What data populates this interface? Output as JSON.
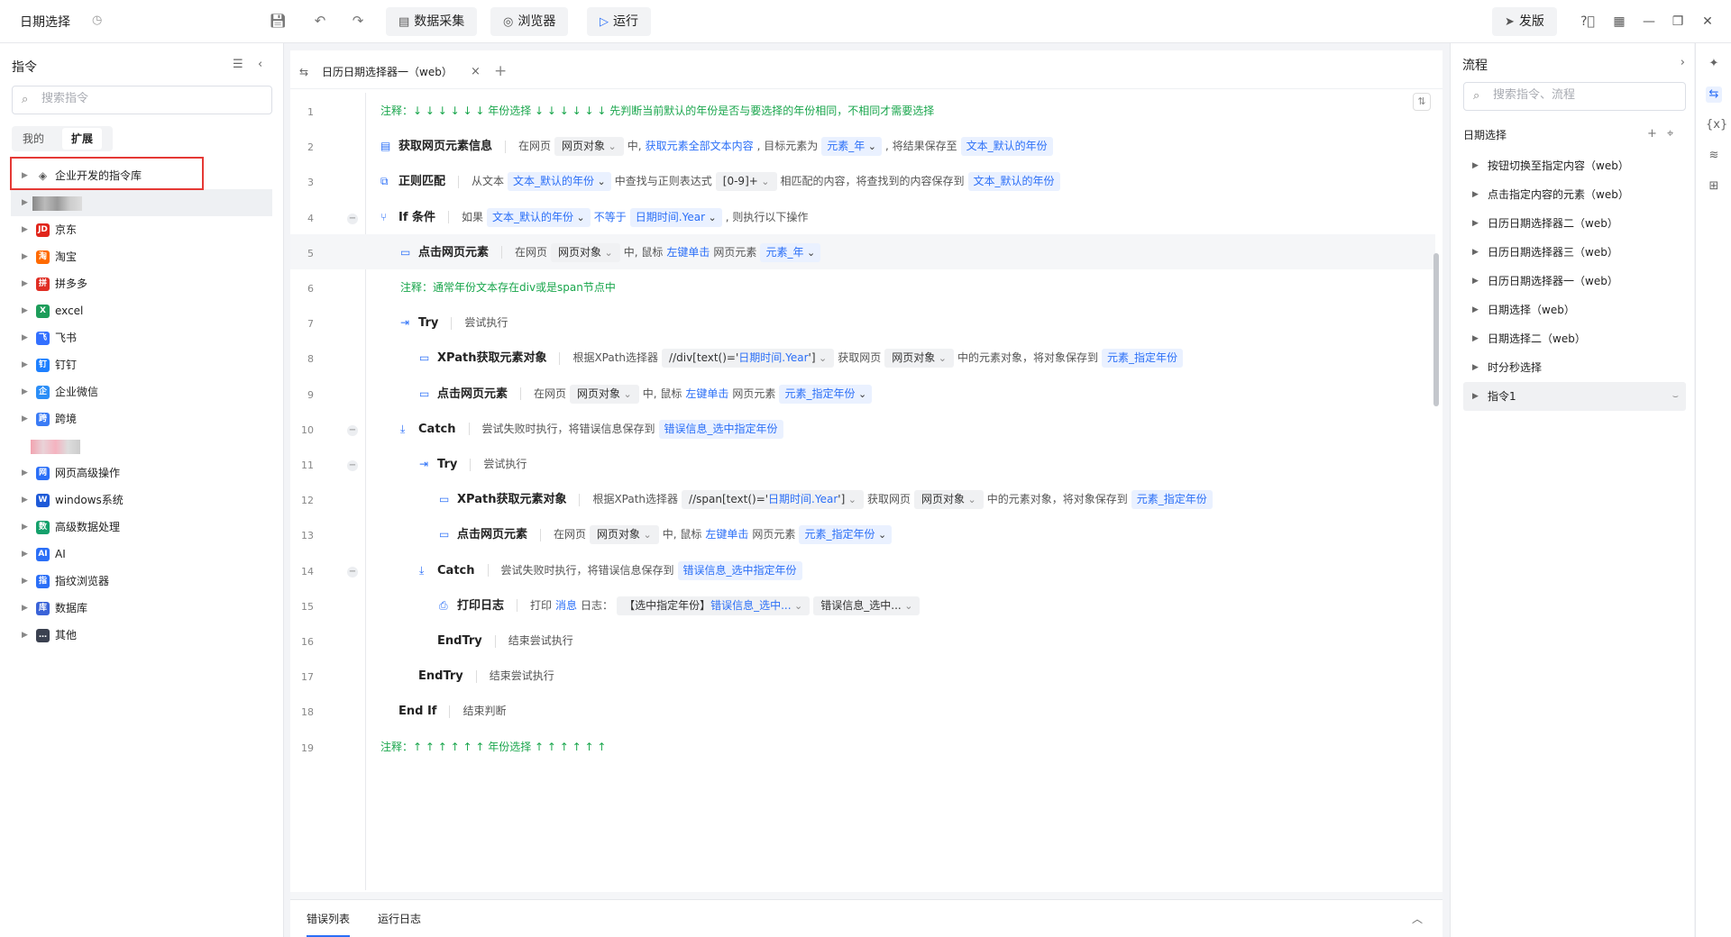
{
  "app": {
    "title": "日期选择",
    "history_icon": "history-icon"
  },
  "toolbar": {
    "data_collect": "数据采集",
    "browser": "浏览器",
    "run": "运行",
    "publish": "发版"
  },
  "left": {
    "header": "指令",
    "search_placeholder": "搜索指令",
    "tabs": [
      "我的",
      "扩展"
    ],
    "items": [
      {
        "label": "企业开发的指令库",
        "icon": "layers-icon",
        "color": ""
      },
      {
        "label": "",
        "blur": true
      },
      {
        "label": "京东",
        "icon": "jd-icon",
        "color": "#e1251b",
        "glyph": "JD"
      },
      {
        "label": "淘宝",
        "icon": "taobao-icon",
        "color": "#ff6a00",
        "glyph": "淘"
      },
      {
        "label": "拼多多",
        "icon": "pdd-icon",
        "color": "#e02e24",
        "glyph": "拼"
      },
      {
        "label": "excel",
        "icon": "excel-icon",
        "color": "#1d9d5a",
        "glyph": "X"
      },
      {
        "label": "飞书",
        "icon": "feishu-icon",
        "color": "#3370ff",
        "glyph": "飞"
      },
      {
        "label": "钉钉",
        "icon": "dingtalk-icon",
        "color": "#1e80ff",
        "glyph": "钉"
      },
      {
        "label": "企业微信",
        "icon": "wecom-icon",
        "color": "#2b8ef7",
        "glyph": "企"
      },
      {
        "label": "跨境",
        "icon": "crossborder-icon",
        "color": "#3a7bf5",
        "glyph": "跨"
      },
      {
        "label": "",
        "blur": true,
        "pink": true
      },
      {
        "label": "网页高级操作",
        "icon": "web-advanced-icon",
        "color": "#2b6ff7",
        "glyph": "网"
      },
      {
        "label": "windows系统",
        "icon": "windows-icon",
        "color": "#1e5ad8",
        "glyph": "W"
      },
      {
        "label": "高级数据处理",
        "icon": "data-process-icon",
        "color": "#14a06b",
        "glyph": "数"
      },
      {
        "label": "AI",
        "icon": "ai-icon",
        "color": "#2b6ff7",
        "glyph": "AI"
      },
      {
        "label": "指纹浏览器",
        "icon": "fingerprint-icon",
        "color": "#2b6ff7",
        "glyph": "指"
      },
      {
        "label": "数据库",
        "icon": "database-icon",
        "color": "#3a63d8",
        "glyph": "库"
      },
      {
        "label": "其他",
        "icon": "more-icon",
        "color": "#3b4150",
        "glyph": "…"
      }
    ]
  },
  "editor": {
    "tab_title": "日历日期选择器一（web）",
    "lines": [
      {
        "n": "1",
        "text": "注释：↓ ↓ ↓ ↓ ↓ ↓  年份选择  ↓ ↓ ↓ ↓ ↓ ↓  先判断当前默认的年份是否与要选择的年份相同，不相同才需要选择"
      },
      {
        "n": "2",
        "name": "获取网页元素信息",
        "t1": "在网页",
        "s1": "网页对象",
        "t2": "中,",
        "l1": "获取元素全部文本内容",
        "t3": ", 目标元素为",
        "v1": "元素_年",
        "t4": ", 将结果保存至",
        "v2": "文本_默认的年份"
      },
      {
        "n": "3",
        "name": "正则匹配",
        "t1": "从文本",
        "s1": "文本_默认的年份",
        "t2": "中查找与正则表达式",
        "s2": "[0-9]+",
        "t3": "相匹配的内容，将查找到的内容保存到",
        "v1": "文本_默认的年份"
      },
      {
        "n": "4",
        "name": "If 条件",
        "t1": "如果",
        "s1": "文本_默认的年份",
        "l1": "不等于",
        "s2": "日期时间.Year",
        "t2": ", 则执行以下操作"
      },
      {
        "n": "5",
        "name": "点击网页元素",
        "t1": "在网页",
        "s1": "网页对象",
        "t2": "中, 鼠标",
        "l1": "左键单击",
        "t3": "网页元素",
        "v1": "元素_年"
      },
      {
        "n": "6",
        "text": "注释：通常年份文本存在div或是span节点中"
      },
      {
        "n": "7",
        "name": "Try",
        "t1": "尝试执行"
      },
      {
        "n": "8",
        "name": "XPath获取元素对象",
        "t1": "根据XPath选择器",
        "s1a": "//div[text()='",
        "s1b": "日期时间.Year",
        "s1c": "']",
        "t2": "获取网页",
        "s2": "网页对象",
        "t3": "中的元素对象，将对象保存到",
        "v1": "元素_指定年份"
      },
      {
        "n": "9",
        "name": "点击网页元素",
        "t1": "在网页",
        "s1": "网页对象",
        "t2": "中, 鼠标",
        "l1": "左键单击",
        "t3": "网页元素",
        "v1": "元素_指定年份"
      },
      {
        "n": "10",
        "name": "Catch",
        "t1": "尝试失败时执行，将错误信息保存到",
        "v1": "错误信息_选中指定年份"
      },
      {
        "n": "11",
        "name": "Try",
        "t1": "尝试执行"
      },
      {
        "n": "12",
        "name": "XPath获取元素对象",
        "t1": "根据XPath选择器",
        "s1a": "//span[text()='",
        "s1b": "日期时间.Year",
        "s1c": "']",
        "t2": "获取网页",
        "s2": "网页对象",
        "t3": "中的元素对象，将对象保存到",
        "v1": "元素_指定年份"
      },
      {
        "n": "13",
        "name": "点击网页元素",
        "t1": "在网页",
        "s1": "网页对象",
        "t2": "中, 鼠标",
        "l1": "左键单击",
        "t3": "网页元素",
        "v1": "元素_指定年份"
      },
      {
        "n": "14",
        "name": "Catch",
        "t1": "尝试失败时执行，将错误信息保存到",
        "v1": "错误信息_选中指定年份"
      },
      {
        "n": "15",
        "name": "打印日志",
        "t1": "打印",
        "l1": "消息",
        "t2": "日志：",
        "s1a": "【选中指定年份】",
        "s1b": "错误信息_选中..."
      },
      {
        "n": "16",
        "name": "EndTry",
        "t1": "结束尝试执行"
      },
      {
        "n": "17",
        "name": "EndTry",
        "t1": "结束尝试执行"
      },
      {
        "n": "18",
        "name": "End If",
        "t1": "结束判断"
      },
      {
        "n": "19",
        "text": "注释：↑ ↑ ↑ ↑ ↑ ↑  年份选择  ↑ ↑ ↑ ↑ ↑ ↑"
      }
    ]
  },
  "bottom": {
    "tabs": [
      "错误列表",
      "运行日志"
    ]
  },
  "right": {
    "header": "流程",
    "search_placeholder": "搜索指令、流程",
    "section": "日期选择",
    "flows": [
      "按钮切换至指定内容（web）",
      "点击指定内容的元素（web）",
      "日历日期选择器二（web）",
      "日历日期选择器三（web）",
      "日历日期选择器一（web）",
      "日期选择（web）",
      "日期选择二（web）",
      "时分秒选择",
      "指令1"
    ]
  },
  "colors": {
    "accent": "#2b6ff7",
    "comment": "#19a64c",
    "highlight_box": "#e53935"
  }
}
